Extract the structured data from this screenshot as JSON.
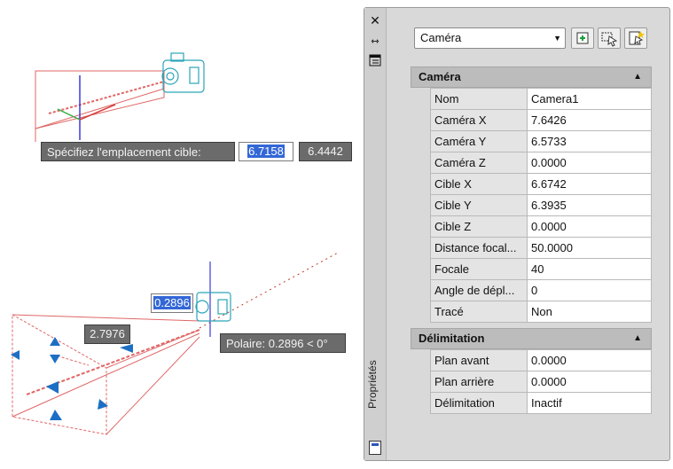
{
  "viewport": {
    "tooltip_label": "Spécifiez l'emplacement cible:",
    "input_x": "6.7158",
    "input_y": "6.4442",
    "dim_input": "0.2896",
    "dim_value": "2.7976",
    "polar_tooltip": "Polaire: 0.2896 < 0°"
  },
  "palette": {
    "title": "Propriétés",
    "object_type": "Caméra",
    "sections": [
      {
        "title": "Caméra",
        "rows": [
          {
            "name": "Nom",
            "value": "Camera1"
          },
          {
            "name": "Caméra X",
            "value": "7.6426"
          },
          {
            "name": "Caméra Y",
            "value": "6.5733"
          },
          {
            "name": "Caméra Z",
            "value": "0.0000"
          },
          {
            "name": "Cible X",
            "value": "6.6742"
          },
          {
            "name": "Cible Y",
            "value": "6.3935"
          },
          {
            "name": "Cible Z",
            "value": "0.0000"
          },
          {
            "name": "Distance focal...",
            "value": "50.0000"
          },
          {
            "name": "Focale",
            "value": "40"
          },
          {
            "name": "Angle de dépl...",
            "value": "0"
          },
          {
            "name": "Tracé",
            "value": "Non"
          }
        ]
      },
      {
        "title": "Délimitation",
        "rows": [
          {
            "name": "Plan avant",
            "value": "0.0000"
          },
          {
            "name": "Plan arrière",
            "value": "0.0000"
          },
          {
            "name": "Délimitation",
            "value": "Inactif"
          }
        ]
      }
    ]
  },
  "icons": {
    "close": "close-icon",
    "autohide": "autohide-icon",
    "properties_menu": "properties-menu-icon",
    "toggle_pickadd": "toggle-pickadd-icon",
    "select_objects": "select-objects-icon",
    "quick_select": "quick-select-icon"
  },
  "colors": {
    "frustum": "#e06666",
    "camera": "#2aa5b8",
    "grip": "#1c6fc4",
    "axis_z": "#3b3bd6",
    "axis_x": "#d63b3b",
    "axis_y": "#3bb04b",
    "highlight": "#3367d6"
  }
}
